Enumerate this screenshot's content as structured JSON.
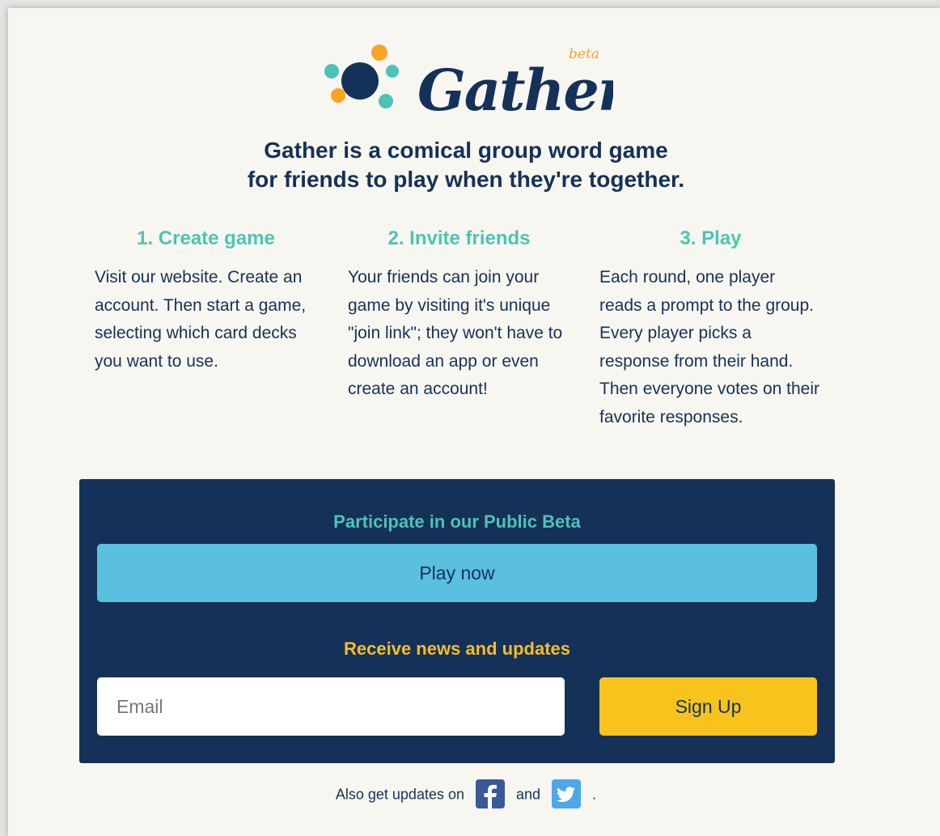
{
  "brand": {
    "name": "Gather",
    "badge": "beta"
  },
  "tagline": {
    "line1": "Gather is a comical group word game",
    "line2": "for friends to play when they're together."
  },
  "steps": [
    {
      "title": "1. Create game",
      "body": "Visit our website. Create an account. Then start a game, selecting which card decks you want to use."
    },
    {
      "title": "2. Invite friends",
      "body": "Your friends can join your game by visiting it's unique \"join link\"; they won't have to download an app or even create an account!"
    },
    {
      "title": "3. Play",
      "body": "Each round, one player reads a prompt to the group. Every player picks a response from their hand. Then everyone votes on their favorite responses."
    }
  ],
  "beta": {
    "heading": "Participate in our Public Beta",
    "play_label": "Play now"
  },
  "news": {
    "heading": "Receive news and updates",
    "email_placeholder": "Email",
    "signup_label": "Sign Up"
  },
  "footer": {
    "prefix": "Also get updates on",
    "and": "and",
    "suffix": ".",
    "icons": [
      "facebook-icon",
      "twitter-icon"
    ]
  },
  "colors": {
    "navy": "#143259",
    "teal": "#4cc3b9",
    "orange": "#f6a623",
    "yellow": "#f8c31c",
    "sky": "#5bbfe0",
    "background": "#f8f6f0"
  }
}
